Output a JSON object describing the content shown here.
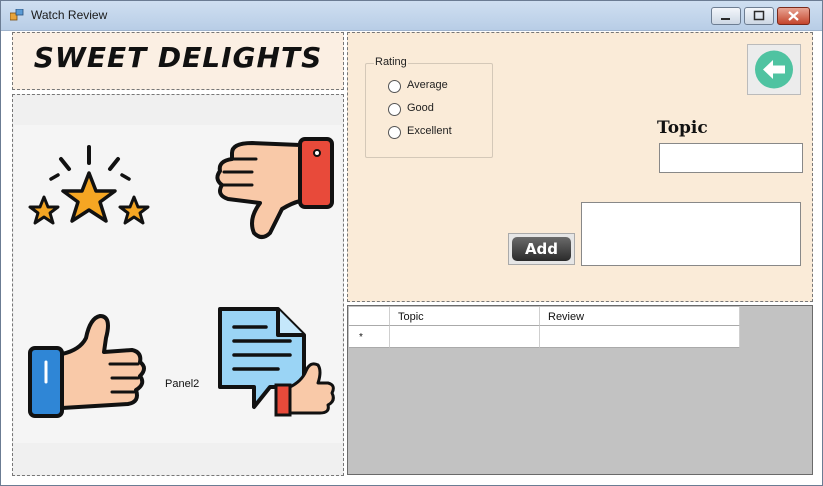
{
  "window": {
    "title": "Watch Review"
  },
  "brand": {
    "title": "SWEET DELIGHTS"
  },
  "images_panel": {
    "label": "Panel2"
  },
  "rating": {
    "group_label": "Rating",
    "options": [
      {
        "label": "Average",
        "selected": false
      },
      {
        "label": "Good",
        "selected": false
      },
      {
        "label": "Excellent",
        "selected": false
      }
    ]
  },
  "topic": {
    "label": "Topic",
    "value": ""
  },
  "review": {
    "value": ""
  },
  "add_button": {
    "label": "Add"
  },
  "grid": {
    "columns": [
      "Topic",
      "Review"
    ],
    "new_row_marker": "*"
  },
  "colors": {
    "title_panel_bg": "#fbefe3",
    "form_panel_bg": "#faebd8",
    "grid_bg": "#c2c2c2",
    "back_button_accent": "#4fc3a1"
  },
  "icons": [
    "stars-rating-icon",
    "thumbs-down-icon",
    "thumbs-up-icon",
    "review-document-icon",
    "back-arrow-icon"
  ]
}
